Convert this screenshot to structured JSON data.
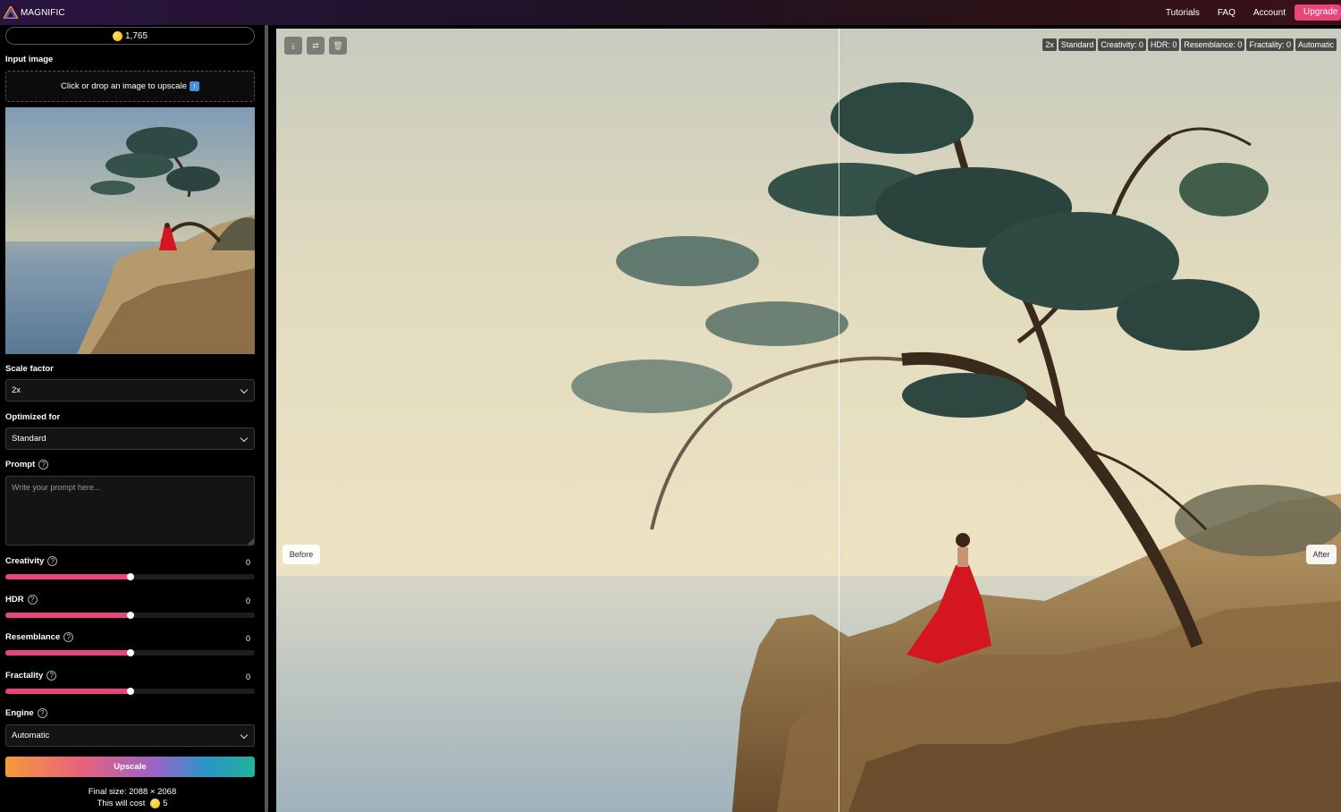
{
  "app": {
    "name": "MAGNIFIC"
  },
  "nav": {
    "tutorials": "Tutorials",
    "faq": "FAQ",
    "account": "Account",
    "upgrade": "Upgrade"
  },
  "sidebar": {
    "credits": "1,765",
    "input_label": "Input image",
    "dropzone_text": "Click or drop an image to upscale",
    "scale_label": "Scale factor",
    "scale_value": "2x",
    "optimized_label": "Optimized for",
    "optimized_value": "Standard",
    "prompt_label": "Prompt",
    "prompt_placeholder": "Write your prompt here...",
    "sliders": [
      {
        "label": "Creativity",
        "value": "0",
        "fraction": 0.5
      },
      {
        "label": "HDR",
        "value": "0",
        "fraction": 0.5
      },
      {
        "label": "Resemblance",
        "value": "0",
        "fraction": 0.5
      },
      {
        "label": "Fractality",
        "value": "0",
        "fraction": 0.5
      }
    ],
    "engine_label": "Engine",
    "engine_value": "Automatic",
    "upscale_button": "Upscale",
    "final_size": "Final size: 2088 × 2068",
    "cost_prefix": "This will cost",
    "cost_value": "5"
  },
  "compare": {
    "before": "Before",
    "after": "After",
    "tags": [
      "2x",
      "Standard",
      "Creativity: 0",
      "HDR: 0",
      "Resemblance: 0",
      "Fractality: 0",
      "Automatic"
    ]
  },
  "icons": {
    "download": "download-icon",
    "swap": "swap-icon",
    "trash": "trash-icon",
    "help": "help-icon",
    "chevron": "chevron-down-icon",
    "coin": "coin-icon",
    "upload": "upload-arrow-icon"
  },
  "colors": {
    "accent": "#e8457a",
    "background": "#000000"
  }
}
